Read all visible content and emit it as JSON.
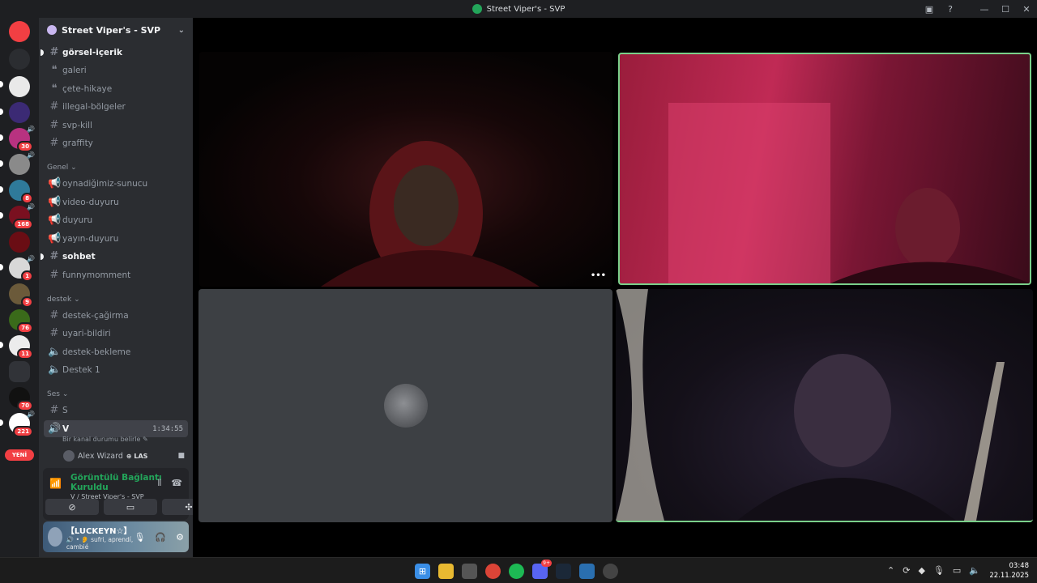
{
  "window": {
    "title": "Street Viper's - SVP"
  },
  "guild_rail": {
    "badges": [
      "30",
      "8",
      "168",
      "1",
      "9",
      "76",
      "11",
      "70",
      "221"
    ],
    "new_label": "YENİ"
  },
  "server": {
    "name": "Street Viper's - SVP"
  },
  "channels": {
    "top": [
      {
        "name": "görsel-içerik",
        "unread": true
      },
      {
        "name": "galeri"
      },
      {
        "name": "çete-hikaye"
      },
      {
        "name": "illegal-bölgeler"
      },
      {
        "name": "svp-kill"
      },
      {
        "name": "graffity"
      }
    ],
    "genel_label": "Genel",
    "genel": [
      {
        "name": "oynadiğimiz-sunucu"
      },
      {
        "name": "video-duyuru"
      },
      {
        "name": "duyuru"
      },
      {
        "name": "yayın-duyuru"
      },
      {
        "name": "sohbet",
        "unread": true
      },
      {
        "name": "funnymomment"
      }
    ],
    "destek_label": "destek",
    "destek": [
      {
        "name": "destek-çağirma"
      },
      {
        "name": "uyari-bildiri"
      },
      {
        "name": "destek-bekleme"
      },
      {
        "name": "Destek 1"
      }
    ],
    "ses_label": "Ses",
    "ses": [
      {
        "name": "S"
      },
      {
        "name": "V",
        "timer": "1:34:55"
      }
    ],
    "channel_status_placeholder": "Bir kanal durumu belirle",
    "member": {
      "name": "Alex Wizard",
      "tag": "LAS"
    }
  },
  "voice_panel": {
    "status": "Görüntülü Bağlantı Kuruldu",
    "location": "V / Street Viper's - SVP"
  },
  "user": {
    "name": "【LUCKEYN☆】",
    "status": "sufri, aprendí, cambié"
  },
  "taskbar": {
    "discord_badge": "9+",
    "time": "03:48",
    "date": "22.11.2025"
  }
}
